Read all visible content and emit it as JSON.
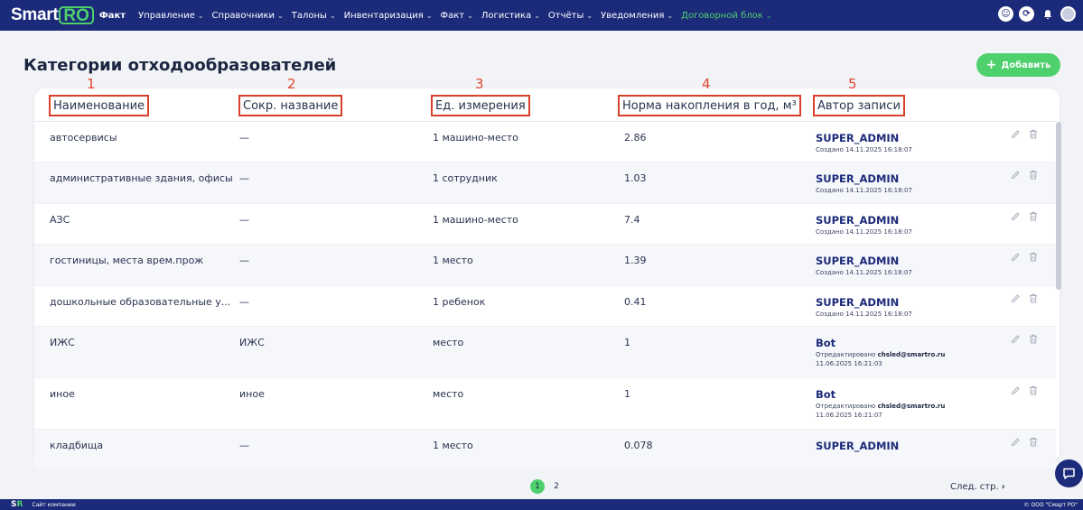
{
  "app": {
    "logo_main": "Smart",
    "logo_accent": "RO",
    "logo_sub": "Факт"
  },
  "nav": [
    {
      "label": "Управление",
      "active": false
    },
    {
      "label": "Справочники",
      "active": false
    },
    {
      "label": "Талоны",
      "active": false
    },
    {
      "label": "Инвентаризация",
      "active": false
    },
    {
      "label": "Факт",
      "active": false
    },
    {
      "label": "Логистика",
      "active": false
    },
    {
      "label": "Отчёты",
      "active": false
    },
    {
      "label": "Уведомления",
      "active": false
    },
    {
      "label": "Договорной блок",
      "active": true
    }
  ],
  "top_icons": [
    "support-icon",
    "refresh-icon",
    "bell-icon",
    "avatar"
  ],
  "page": {
    "title": "Категории отходообразователей",
    "add_label": "Добавить"
  },
  "table": {
    "column_numbers": [
      "1",
      "2",
      "3",
      "4",
      "5"
    ],
    "columns": [
      "Наименование",
      "Сокр. название",
      "Ед. измерения",
      "Норма накопления в год, м³",
      "Автор записи"
    ],
    "rows": [
      {
        "name": "автосервисы",
        "short": "—",
        "unit": "1 машино-место",
        "norm": "2.86",
        "author": "SUPER_ADMIN",
        "meta_prefix": "Создано 14.11.2025 16:18:07",
        "meta_user": "",
        "meta_date": ""
      },
      {
        "name": "административные здания, офисы",
        "short": "—",
        "unit": "1 сотрудник",
        "norm": "1.03",
        "author": "SUPER_ADMIN",
        "meta_prefix": "Создано 14.11.2025 16:18:07",
        "meta_user": "",
        "meta_date": ""
      },
      {
        "name": "АЗС",
        "short": "—",
        "unit": "1 машино-место",
        "norm": "7.4",
        "author": "SUPER_ADMIN",
        "meta_prefix": "Создано 14.11.2025 16:18:07",
        "meta_user": "",
        "meta_date": ""
      },
      {
        "name": "гостиницы, места врем.прож",
        "short": "—",
        "unit": "1 место",
        "norm": "1.39",
        "author": "SUPER_ADMIN",
        "meta_prefix": "Создано 14.11.2025 16:18:07",
        "meta_user": "",
        "meta_date": ""
      },
      {
        "name": "дошкольные образовательные у...",
        "short": "—",
        "unit": "1 ребенок",
        "norm": "0.41",
        "author": "SUPER_ADMIN",
        "meta_prefix": "Создано 14.11.2025 16:18:07",
        "meta_user": "",
        "meta_date": ""
      },
      {
        "name": "ИЖС",
        "short": "ИЖС",
        "unit": "место",
        "norm": "1",
        "author": "Bot",
        "meta_prefix": "Отредактировано",
        "meta_user": "chsled@smartro.ru",
        "meta_date": "11.06.2025 16:21:03"
      },
      {
        "name": "иное",
        "short": "иное",
        "unit": "место",
        "norm": "1",
        "author": "Bot",
        "meta_prefix": "Отредактировано",
        "meta_user": "chsled@smartro.ru",
        "meta_date": "11.06.2025 16:21:07"
      },
      {
        "name": "кладбища",
        "short": "—",
        "unit": "1 место",
        "norm": "0.078",
        "author": "SUPER_ADMIN",
        "meta_prefix": "",
        "meta_user": "",
        "meta_date": ""
      }
    ]
  },
  "pagination": {
    "pages": [
      "1",
      "2"
    ],
    "current": "1",
    "next_label": "След. стр."
  },
  "footer": {
    "logo_left": "S",
    "logo_right": "R",
    "link": "Сайт компании",
    "copyright": "© ООО \"Смарт РО\""
  },
  "colors": {
    "brand_navy": "#1c2a7a",
    "brand_green": "#4ed06d",
    "annotation_red": "#d9402a"
  }
}
